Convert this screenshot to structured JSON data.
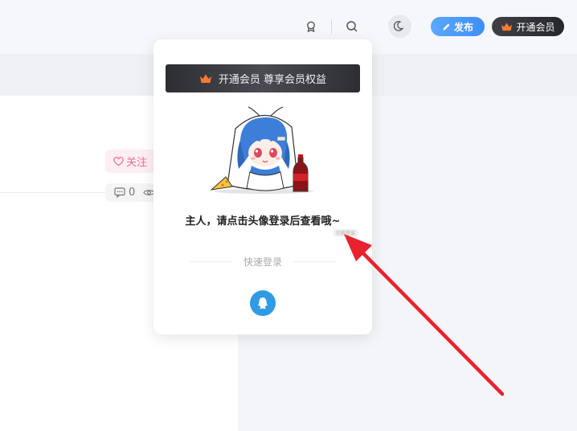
{
  "header": {
    "publish_label": "发布",
    "vip_label": "开通会员",
    "icons": [
      "badge-icon",
      "search-icon",
      "moon-icon"
    ]
  },
  "post": {
    "follow_label": "关注",
    "comment_count": "0"
  },
  "popup": {
    "banner_text": "开通会员 尊享会员权益",
    "message": "主人，请点击头像登录后查看哦~",
    "tag_text": "切换登录",
    "quick_login_label": "快速登录",
    "login_method": "qq-icon"
  },
  "colors": {
    "publish": "#3e8ef7",
    "vip_bg": "#26272b",
    "follow_text": "#f26a8d",
    "qq": "#2f9ae6",
    "annotation_arrow": "#e8222e"
  }
}
